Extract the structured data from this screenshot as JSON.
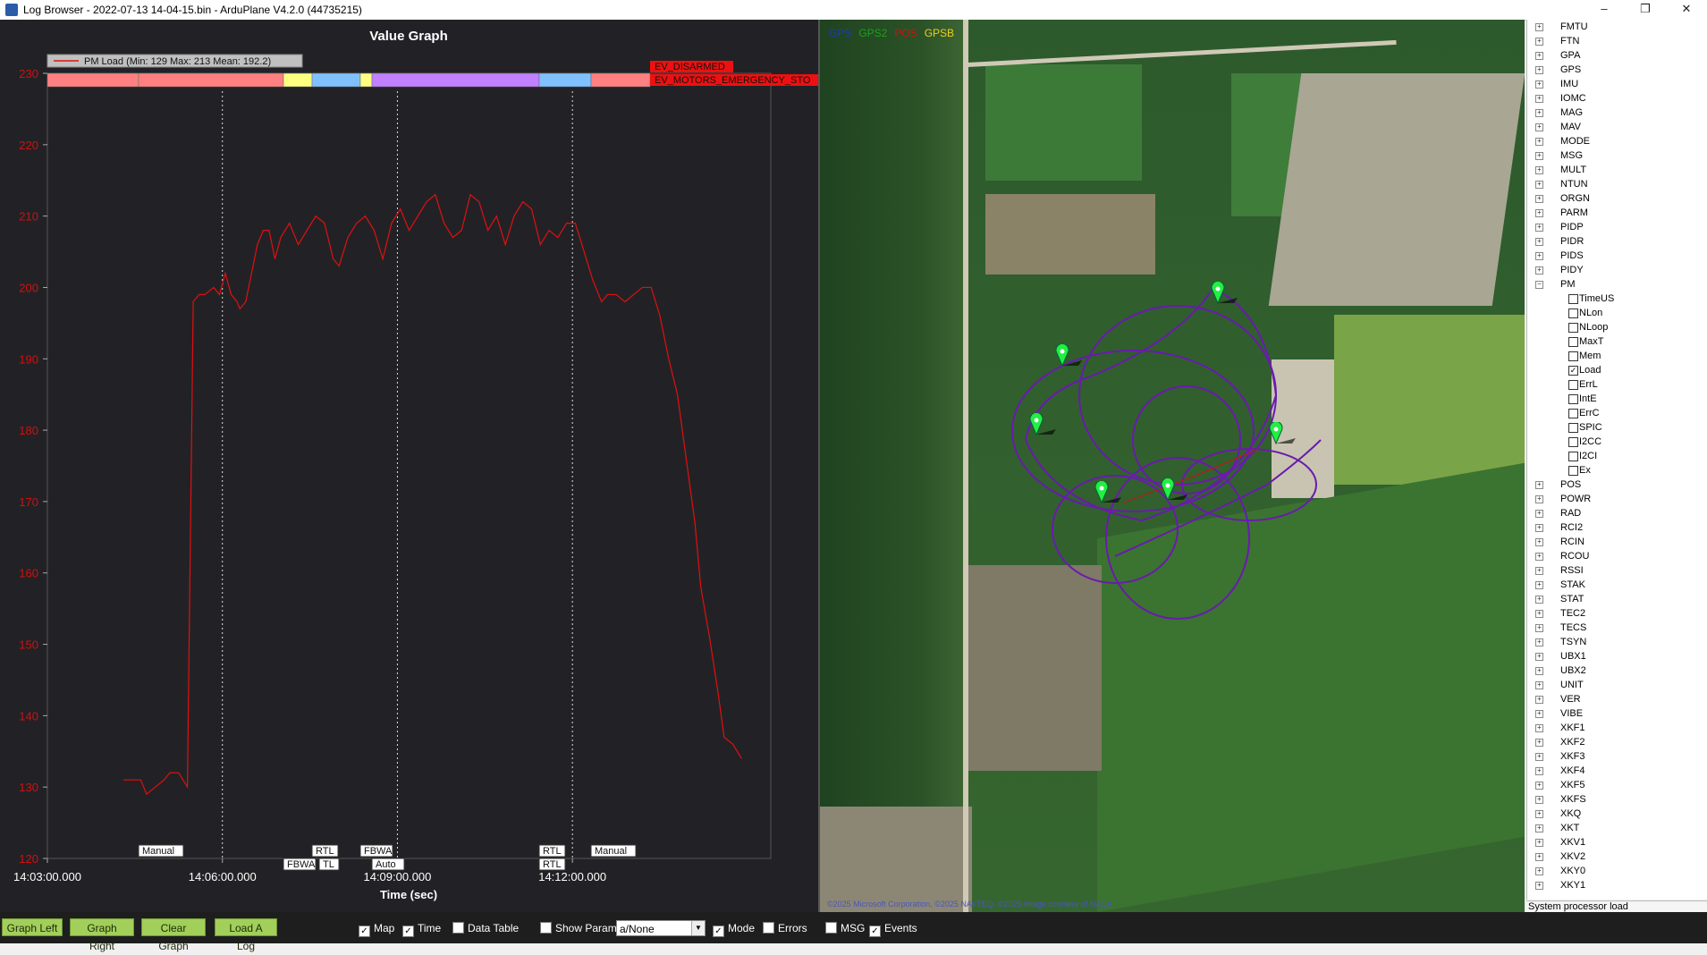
{
  "window": {
    "title": "Log Browser - 2022-07-13 14-04-15.bin - ArduPlane V4.2.0 (44735215)",
    "minimize": "–",
    "maximize": "❐",
    "close": "✕"
  },
  "graph": {
    "title": "Value Graph",
    "legend": "PM Load  (Min: 129 Max: 213 Mean: 192.2)",
    "xlabel": "Time (sec)",
    "events": [
      "EV_DISARMED",
      "EV_MOTORS_EMERGENCY_STO"
    ],
    "modes_top": [
      "Manual",
      "RTL",
      "FBWA",
      "RTL",
      "Manual"
    ],
    "modes_bottom": [
      "FBWA",
      "TL",
      "Auto",
      "RTL"
    ],
    "colors": {
      "line": "#e01010",
      "axis_text": "#d01010"
    }
  },
  "chart_data": {
    "type": "line",
    "title": "Value Graph",
    "xlabel": "Time (sec)",
    "ylabel": "",
    "ylim": [
      120,
      230
    ],
    "yticks": [
      "120",
      "130",
      "140",
      "150",
      "160",
      "170",
      "180",
      "190",
      "200",
      "210",
      "220",
      "230"
    ],
    "xticks": [
      "14:03:00.000",
      "14:06:00.000",
      "14:09:00.000",
      "14:12:00.000"
    ],
    "series": [
      {
        "name": "PM Load",
        "x_minutes": [
          1.3,
          1.6,
          1.7,
          1.85,
          2.0,
          2.1,
          2.25,
          2.4,
          2.5,
          2.6,
          2.7,
          2.85,
          2.95,
          3.05,
          3.15,
          3.25,
          3.3,
          3.4,
          3.6,
          3.7,
          3.8,
          3.9,
          4.0,
          4.15,
          4.3,
          4.45,
          4.6,
          4.75,
          4.9,
          5.0,
          5.15,
          5.3,
          5.45,
          5.6,
          5.75,
          5.9,
          6.05,
          6.2,
          6.35,
          6.5,
          6.65,
          6.8,
          6.95,
          7.1,
          7.25,
          7.4,
          7.55,
          7.7,
          7.85,
          8.0,
          8.15,
          8.3,
          8.45,
          8.6,
          8.75,
          8.9,
          9.05,
          9.2,
          9.35,
          9.5,
          9.6,
          9.75,
          9.9,
          10.05,
          10.2,
          10.35,
          10.5,
          10.65,
          10.8,
          10.95,
          11.1,
          11.2,
          11.35,
          11.5,
          11.6,
          11.75,
          11.9
        ],
        "values": [
          131,
          131,
          129,
          130,
          131,
          132,
          132,
          130,
          198,
          199,
          199,
          200,
          199,
          202,
          199,
          198,
          197,
          198,
          206,
          208,
          208,
          204,
          207,
          209,
          206,
          208,
          210,
          209,
          204,
          203,
          207,
          209,
          210,
          208,
          204,
          209,
          211,
          208,
          210,
          212,
          213,
          209,
          207,
          208,
          213,
          212,
          208,
          210,
          206,
          210,
          212,
          211,
          206,
          208,
          207,
          209,
          209,
          205,
          201,
          198,
          199,
          199,
          198,
          199,
          200,
          200,
          196,
          190,
          185,
          176,
          167,
          158,
          151,
          143,
          137,
          136,
          134
        ]
      }
    ],
    "legend": "top-left",
    "grid": "vertical dotted"
  },
  "map": {
    "legend": [
      "GPS",
      "GPS2",
      "POS",
      "GPSB"
    ],
    "legend_colors": [
      "#1a3bbd",
      "#1aa21a",
      "#d01010",
      "#e8d020"
    ],
    "copyright": "©2025 Microsoft Corporation, ©2025 NAVTEQ, ©2025 Image courtesy of NASA",
    "marker_icon": "map-marker-icon"
  },
  "tree": {
    "items": [
      "FMTU",
      "FTN",
      "GPA",
      "GPS",
      "IMU",
      "IOMC",
      "MAG",
      "MAV",
      "MODE",
      "MSG",
      "MULT",
      "NTUN",
      "ORGN",
      "PARM",
      "PIDP",
      "PIDR",
      "PIDS",
      "PIDY",
      "PM"
    ],
    "pm_children": [
      {
        "label": "TimeUS",
        "checked": false
      },
      {
        "label": "NLon",
        "checked": false
      },
      {
        "label": "NLoop",
        "checked": false
      },
      {
        "label": "MaxT",
        "checked": false
      },
      {
        "label": "Mem",
        "checked": false
      },
      {
        "label": "Load",
        "checked": true
      },
      {
        "label": "ErrL",
        "checked": false
      },
      {
        "label": "IntE",
        "checked": false
      },
      {
        "label": "ErrC",
        "checked": false
      },
      {
        "label": "SPIC",
        "checked": false
      },
      {
        "label": "I2CC",
        "checked": false
      },
      {
        "label": "I2CI",
        "checked": false
      },
      {
        "label": "Ex",
        "checked": false
      }
    ],
    "items_after": [
      "POS",
      "POWR",
      "RAD",
      "RCI2",
      "RCIN",
      "RCOU",
      "RSSI",
      "STAK",
      "STAT",
      "TEC2",
      "TECS",
      "TSYN",
      "UBX1",
      "UBX2",
      "UNIT",
      "VER",
      "VIBE",
      "XKF1",
      "XKF2",
      "XKF3",
      "XKF4",
      "XKF5",
      "XKFS",
      "XKQ",
      "XKT",
      "XKV1",
      "XKV2",
      "XKY0",
      "XKY1"
    ],
    "description": "System processor load"
  },
  "toolbar": {
    "buttons": [
      "Graph Left",
      "Graph Right",
      "Clear Graph",
      "Load A Log"
    ],
    "checks": [
      {
        "label": "Map",
        "checked": true
      },
      {
        "label": "Time",
        "checked": true
      },
      {
        "label": "Data Table",
        "checked": false
      },
      {
        "label": "Show Params",
        "checked": false
      }
    ],
    "combo_value": "a/None",
    "checks2": [
      {
        "label": "Mode",
        "checked": true
      },
      {
        "label": "Errors",
        "checked": false
      },
      {
        "label": "MSG",
        "checked": false
      },
      {
        "label": "Events",
        "checked": true
      }
    ]
  }
}
